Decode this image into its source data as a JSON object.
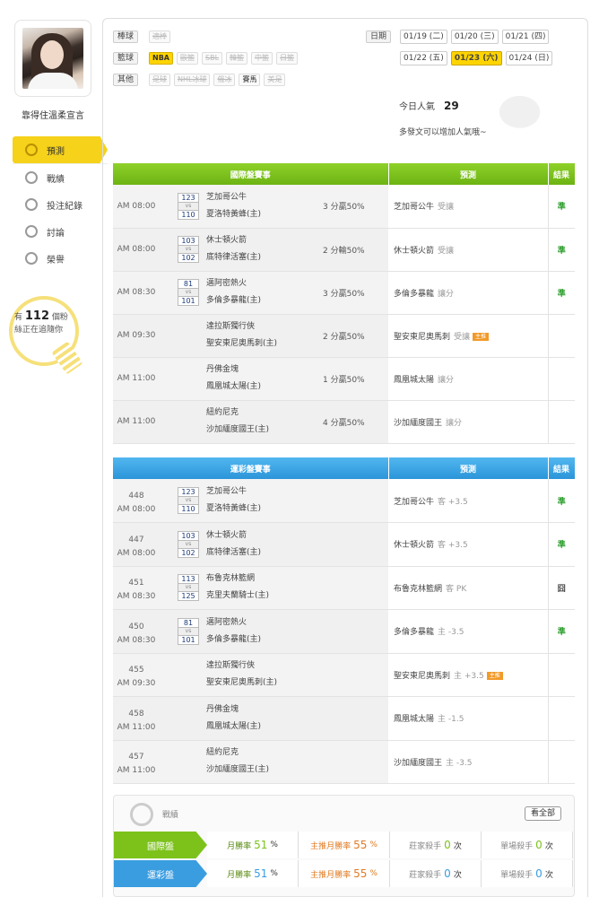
{
  "user": {
    "name": "靠得住溫柔宣言"
  },
  "sidebar": {
    "items": [
      {
        "label": "預測",
        "icon": "target-icon"
      },
      {
        "label": "戰績",
        "icon": "medal-icon"
      },
      {
        "label": "投注紀錄",
        "icon": "circle-icon"
      },
      {
        "label": "討論",
        "icon": "chat-icon"
      },
      {
        "label": "榮譽",
        "icon": "star-icon"
      }
    ]
  },
  "fans": {
    "prefix": "有",
    "count": "112",
    "suffix": "個粉",
    "line2": "絲正在追隨你"
  },
  "sports": [
    {
      "label": "棒球",
      "chips": [
        {
          "t": "適棒",
          "s": "off"
        }
      ]
    },
    {
      "label": "籃球",
      "chips": [
        {
          "t": "NBA",
          "s": "on"
        },
        {
          "t": "歐籃",
          "s": "off"
        },
        {
          "t": "SBL",
          "s": "off"
        },
        {
          "t": "韓籃",
          "s": "off"
        },
        {
          "t": "中籃",
          "s": "off"
        },
        {
          "t": "日籃",
          "s": "off"
        }
      ]
    },
    {
      "label": "其他",
      "chips": [
        {
          "t": "足球",
          "s": "off"
        },
        {
          "t": "NHL冰球",
          "s": "off"
        },
        {
          "t": "俄冰",
          "s": "off"
        },
        {
          "t": "賽馬",
          "s": "act"
        },
        {
          "t": "美足",
          "s": "off"
        }
      ]
    }
  ],
  "dates": {
    "label": "日期",
    "row1": [
      "01/19 (二)",
      "01/20 (三)",
      "01/21 (四)"
    ],
    "row2": [
      "01/22 (五)",
      "01/23 (六)",
      "01/24 (日)"
    ],
    "selected": "01/23 (六)"
  },
  "popularity": {
    "label": "今日人氣",
    "value": "29",
    "hint": "多發文可以增加人氣哦~"
  },
  "intl": {
    "headers": [
      "國際盤賽事",
      "預測",
      "結果"
    ],
    "rows": [
      {
        "time": "AM 08:00",
        "s1": "123",
        "s2": "110",
        "t1": "芝加哥公牛",
        "t2": "夏洛特黃蜂(主)",
        "res": "3 分贏50%",
        "pick": "芝加哥公牛",
        "type": "受讓",
        "flag": "",
        "result": "準"
      },
      {
        "time": "AM 08:00",
        "s1": "103",
        "s2": "102",
        "t1": "休士頓火箭",
        "t2": "底特律活塞(主)",
        "res": "2 分輸50%",
        "pick": "休士頓火箭",
        "type": "受讓",
        "flag": "",
        "result": "準"
      },
      {
        "time": "AM 08:30",
        "s1": "81",
        "s2": "101",
        "t1": "邁阿密熱火",
        "t2": "多倫多暴龍(主)",
        "res": "3 分贏50%",
        "pick": "多倫多暴龍",
        "type": "讓分",
        "flag": "",
        "result": "準"
      },
      {
        "time": "AM 09:30",
        "s1": "",
        "s2": "",
        "t1": "達拉斯獨行俠",
        "t2": "聖安東尼奧馬刺(主)",
        "res": "2 分贏50%",
        "pick": "聖安東尼奧馬刺",
        "type": "受讓",
        "flag": "主推",
        "result": ""
      },
      {
        "time": "AM 11:00",
        "s1": "",
        "s2": "",
        "t1": "丹佛金塊",
        "t2": "鳳凰城太陽(主)",
        "res": "1 分贏50%",
        "pick": "鳳凰城太陽",
        "type": "讓分",
        "flag": "",
        "result": ""
      },
      {
        "time": "AM 11:00",
        "s1": "",
        "s2": "",
        "t1": "紐約尼克",
        "t2": "沙加緬度國王(主)",
        "res": "4 分贏50%",
        "pick": "沙加緬度國王",
        "type": "讓分",
        "flag": "",
        "result": ""
      }
    ]
  },
  "lottery": {
    "headers": [
      "運彩盤賽事",
      "預測",
      "結果"
    ],
    "rows": [
      {
        "num": "448",
        "time": "AM 08:00",
        "s1": "123",
        "s2": "110",
        "t1": "芝加哥公牛",
        "t2": "夏洛特黃蜂(主)",
        "pick": "芝加哥公牛",
        "type": "客 +3.5",
        "flag": "",
        "result": "準"
      },
      {
        "num": "447",
        "time": "AM 08:00",
        "s1": "103",
        "s2": "102",
        "t1": "休士頓火箭",
        "t2": "底特律活塞(主)",
        "pick": "休士頓火箭",
        "type": "客 +3.5",
        "flag": "",
        "result": "準"
      },
      {
        "num": "451",
        "time": "AM 08:30",
        "s1": "113",
        "s2": "125",
        "t1": "布魯克林籃網",
        "t2": "克里夫蘭騎士(主)",
        "pick": "布魯克林籃網",
        "type": "客 PK",
        "flag": "",
        "result": "囧"
      },
      {
        "num": "450",
        "time": "AM 08:30",
        "s1": "81",
        "s2": "101",
        "t1": "邁阿密熱火",
        "t2": "多倫多暴龍(主)",
        "pick": "多倫多暴龍",
        "type": "主 -3.5",
        "flag": "",
        "result": "準"
      },
      {
        "num": "455",
        "time": "AM 09:30",
        "s1": "",
        "s2": "",
        "t1": "達拉斯獨行俠",
        "t2": "聖安東尼奧馬刺(主)",
        "pick": "聖安東尼奧馬刺",
        "type": "主 +3.5",
        "flag": "主推",
        "result": ""
      },
      {
        "num": "458",
        "time": "AM 11:00",
        "s1": "",
        "s2": "",
        "t1": "丹佛金塊",
        "t2": "鳳凰城太陽(主)",
        "pick": "鳳凰城太陽",
        "type": "主 -1.5",
        "flag": "",
        "result": ""
      },
      {
        "num": "457",
        "time": "AM 11:00",
        "s1": "",
        "s2": "",
        "t1": "紐約尼克",
        "t2": "沙加緬度國王(主)",
        "pick": "沙加緬度國王",
        "type": "主 -3.5",
        "flag": "",
        "result": ""
      }
    ]
  },
  "record": {
    "title": "戰績",
    "see_all": "看全部",
    "rows": [
      {
        "label": "國際盤",
        "color": "#7cc21b",
        "c1": [
          "月勝率",
          "51",
          "%"
        ],
        "c2": [
          "主推月勝率",
          "55",
          "%"
        ],
        "c3": [
          "莊家殺手",
          "0",
          "次"
        ],
        "c4": [
          "單場殺手",
          "0",
          "次"
        ]
      },
      {
        "label": "運彩盤",
        "color": "#3a9de0",
        "c1": [
          "月勝率",
          "51",
          "%"
        ],
        "c2": [
          "主推月勝率",
          "55",
          "%"
        ],
        "c3": [
          "莊家殺手",
          "0",
          "次"
        ],
        "c4": [
          "單場殺手",
          "0",
          "次"
        ]
      }
    ]
  },
  "colors": {
    "green": "#7cc21b",
    "blue": "#3a9de0",
    "yellow": "#ffd400",
    "orange": "#f19a2a"
  }
}
